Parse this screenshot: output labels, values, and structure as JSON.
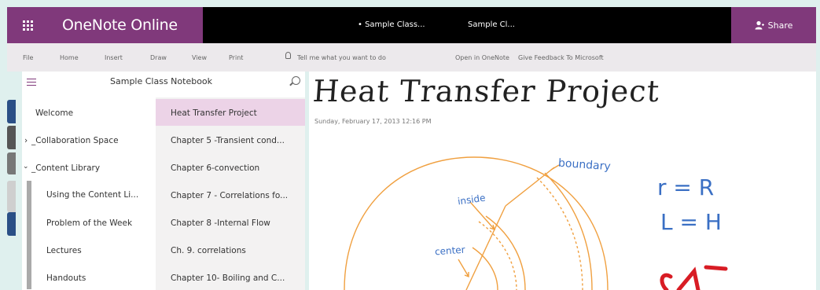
{
  "titlebar": {
    "app_name": "OneNote Online",
    "breadcrumb_1": "• Sample Class...",
    "breadcrumb_2": "Sample Cl...",
    "share_label": "Share"
  },
  "ribbon": {
    "items": [
      "File",
      "Home",
      "Insert",
      "Draw",
      "View",
      "Print"
    ],
    "tell_me": "Tell me what you want to do",
    "open_in_onenote": "Open in OneNote",
    "give_feedback": "Give Feedback To Microsoft"
  },
  "notebook": {
    "title": "Sample Class Notebook",
    "sections": [
      {
        "label": "Welcome"
      },
      {
        "label": "_Collaboration Space"
      },
      {
        "label": "_Content Library"
      },
      {
        "label": "Using the Content Li..."
      },
      {
        "label": "Problem of the Week"
      },
      {
        "label": "Lectures"
      },
      {
        "label": "Handouts"
      }
    ],
    "pages": [
      {
        "label": "Heat Transfer Project"
      },
      {
        "label": "Chapter 5 -Transient cond..."
      },
      {
        "label": "Chapter 6-convection"
      },
      {
        "label": "Chapter 7 - Correlations fo..."
      },
      {
        "label": "Chapter 8 -Internal Flow"
      },
      {
        "label": "Ch. 9. correlations"
      },
      {
        "label": "Chapter 10- Boiling and C..."
      }
    ]
  },
  "page": {
    "title": "Heat Transfer Project",
    "date": "Sunday, February 17, 2013    12:16 PM",
    "ink": {
      "boundary": "boundary",
      "inside": "inside",
      "center": "center",
      "eq1": "r = R",
      "eq2": "L = H"
    }
  },
  "colors": {
    "brand": "#80397b",
    "selected_page": "#ecd3e7",
    "ink_orange": "#f0a040",
    "ink_blue": "#3a6fc4",
    "ink_red": "#d81c24"
  }
}
